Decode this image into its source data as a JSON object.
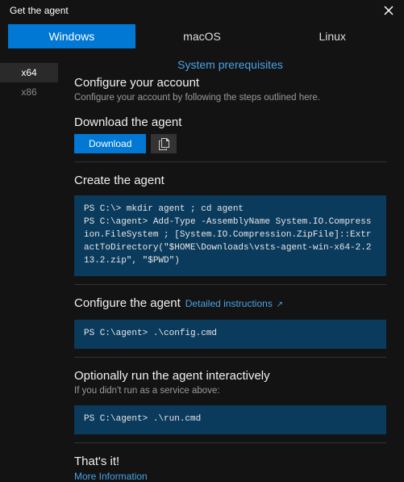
{
  "header": {
    "title": "Get the agent"
  },
  "tabs": {
    "os": [
      "Windows",
      "macOS",
      "Linux"
    ],
    "arch": [
      "x64",
      "x86"
    ]
  },
  "prereq_link": "System prerequisites",
  "sections": {
    "configure_account": {
      "title": "Configure your account",
      "sub": "Configure your account by following the steps outlined here."
    },
    "download": {
      "title": "Download the agent",
      "button": "Download"
    },
    "create": {
      "title": "Create the agent",
      "code": "PS C:\\> mkdir agent ; cd agent\nPS C:\\agent> Add-Type -AssemblyName System.IO.Compression.FileSystem ; [System.IO.Compression.ZipFile]::ExtractToDirectory(\"$HOME\\Downloads\\vsts-agent-win-x64-2.213.2.zip\", \"$PWD\")"
    },
    "configure_agent": {
      "title": "Configure the agent",
      "link": "Detailed instructions",
      "code": "PS C:\\agent> .\\config.cmd"
    },
    "run": {
      "title": "Optionally run the agent interactively",
      "sub": "If you didn't run as a service above:",
      "code": "PS C:\\agent> .\\run.cmd"
    },
    "done": {
      "title": "That's it!",
      "link": "More Information"
    }
  }
}
